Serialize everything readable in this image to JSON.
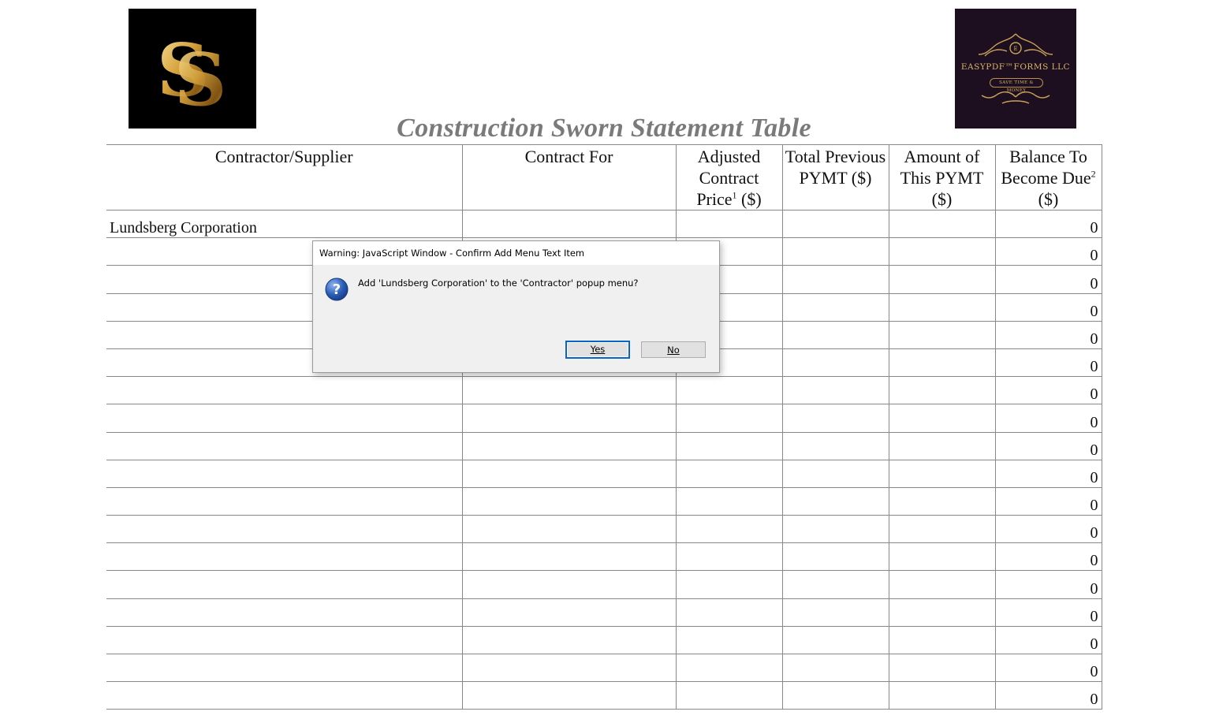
{
  "header": {
    "left_logo_icon": "ss-monogram-logo",
    "right_logo": {
      "icon": "easypdf-forms-logo",
      "brand": "EASYPDF™FORMS LLC",
      "tagline": "SAVE TIME & MONEY"
    },
    "title": "Construction Sworn Statement Table"
  },
  "table": {
    "columns": [
      {
        "label": "Contractor/Supplier"
      },
      {
        "label": "Contract For"
      },
      {
        "label_main": "Adjusted Contract Price",
        "sup": "1",
        "suffix": " ($)"
      },
      {
        "label": "Total Previous PYMT ($)"
      },
      {
        "label": "Amount of This PYMT ($)"
      },
      {
        "label_main": "Balance To Become Due",
        "sup": "2",
        "suffix": " ($)"
      }
    ],
    "rows": [
      {
        "contractor": "Lundsberg Corporation",
        "contract_for": "",
        "adjusted": "",
        "previous": "",
        "this_pymt": "",
        "balance": "0"
      },
      {
        "contractor": "",
        "contract_for": "",
        "adjusted": "",
        "previous": "",
        "this_pymt": "",
        "balance": "0"
      },
      {
        "contractor": "",
        "contract_for": "",
        "adjusted": "",
        "previous": "",
        "this_pymt": "",
        "balance": "0"
      },
      {
        "contractor": "",
        "contract_for": "",
        "adjusted": "",
        "previous": "",
        "this_pymt": "",
        "balance": "0"
      },
      {
        "contractor": "",
        "contract_for": "",
        "adjusted": "",
        "previous": "",
        "this_pymt": "",
        "balance": "0"
      },
      {
        "contractor": "",
        "contract_for": "",
        "adjusted": "",
        "previous": "",
        "this_pymt": "",
        "balance": "0"
      },
      {
        "contractor": "",
        "contract_for": "",
        "adjusted": "",
        "previous": "",
        "this_pymt": "",
        "balance": "0"
      },
      {
        "contractor": "",
        "contract_for": "",
        "adjusted": "",
        "previous": "",
        "this_pymt": "",
        "balance": "0"
      },
      {
        "contractor": "",
        "contract_for": "",
        "adjusted": "",
        "previous": "",
        "this_pymt": "",
        "balance": "0"
      },
      {
        "contractor": "",
        "contract_for": "",
        "adjusted": "",
        "previous": "",
        "this_pymt": "",
        "balance": "0"
      },
      {
        "contractor": "",
        "contract_for": "",
        "adjusted": "",
        "previous": "",
        "this_pymt": "",
        "balance": "0"
      },
      {
        "contractor": "",
        "contract_for": "",
        "adjusted": "",
        "previous": "",
        "this_pymt": "",
        "balance": "0"
      },
      {
        "contractor": "",
        "contract_for": "",
        "adjusted": "",
        "previous": "",
        "this_pymt": "",
        "balance": "0"
      },
      {
        "contractor": "",
        "contract_for": "",
        "adjusted": "",
        "previous": "",
        "this_pymt": "",
        "balance": "0"
      },
      {
        "contractor": "",
        "contract_for": "",
        "adjusted": "",
        "previous": "",
        "this_pymt": "",
        "balance": "0"
      },
      {
        "contractor": "",
        "contract_for": "",
        "adjusted": "",
        "previous": "",
        "this_pymt": "",
        "balance": "0"
      },
      {
        "contractor": "",
        "contract_for": "",
        "adjusted": "",
        "previous": "",
        "this_pymt": "",
        "balance": "0"
      },
      {
        "contractor": "",
        "contract_for": "",
        "adjusted": "",
        "previous": "",
        "this_pymt": "",
        "balance": "0"
      }
    ]
  },
  "dialog": {
    "title": "Warning: JavaScript Window - Confirm Add Menu Text Item",
    "icon": "question-icon",
    "message": "Add 'Lundsberg Corporation' to the 'Contractor' popup menu?",
    "yes_label": "Yes",
    "no_label": "No"
  },
  "colors": {
    "title_gray": "#7a7a7a",
    "grid_line": "#888888",
    "dialog_bg": "#f0f0f0",
    "default_button_border": "#0a64c8",
    "question_icon_blue": "#2a5cb8",
    "gold": "#d9b46a"
  }
}
